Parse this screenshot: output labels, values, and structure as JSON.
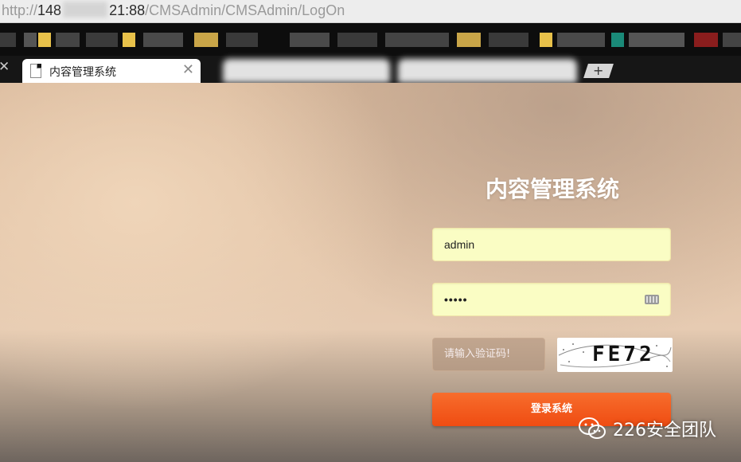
{
  "browser": {
    "url_scheme": "http://",
    "url_host_start": "148",
    "url_host_end": "21:88",
    "url_path": "/CMSAdmin/CMSAdmin/LogOn",
    "active_tab_label": "内容管理系统",
    "new_tab_label": "+"
  },
  "login": {
    "title": "内容管理系统",
    "username_value": "admin",
    "password_value": "•••••",
    "captcha_placeholder": "请输入验证码!",
    "captcha_text": "FE72",
    "submit_label": "登录系统"
  },
  "watermark": {
    "text": "226安全团队"
  },
  "colors": {
    "accent": "#f05a1e",
    "input_fill": "#fafdc4",
    "title": "#ffffff"
  }
}
